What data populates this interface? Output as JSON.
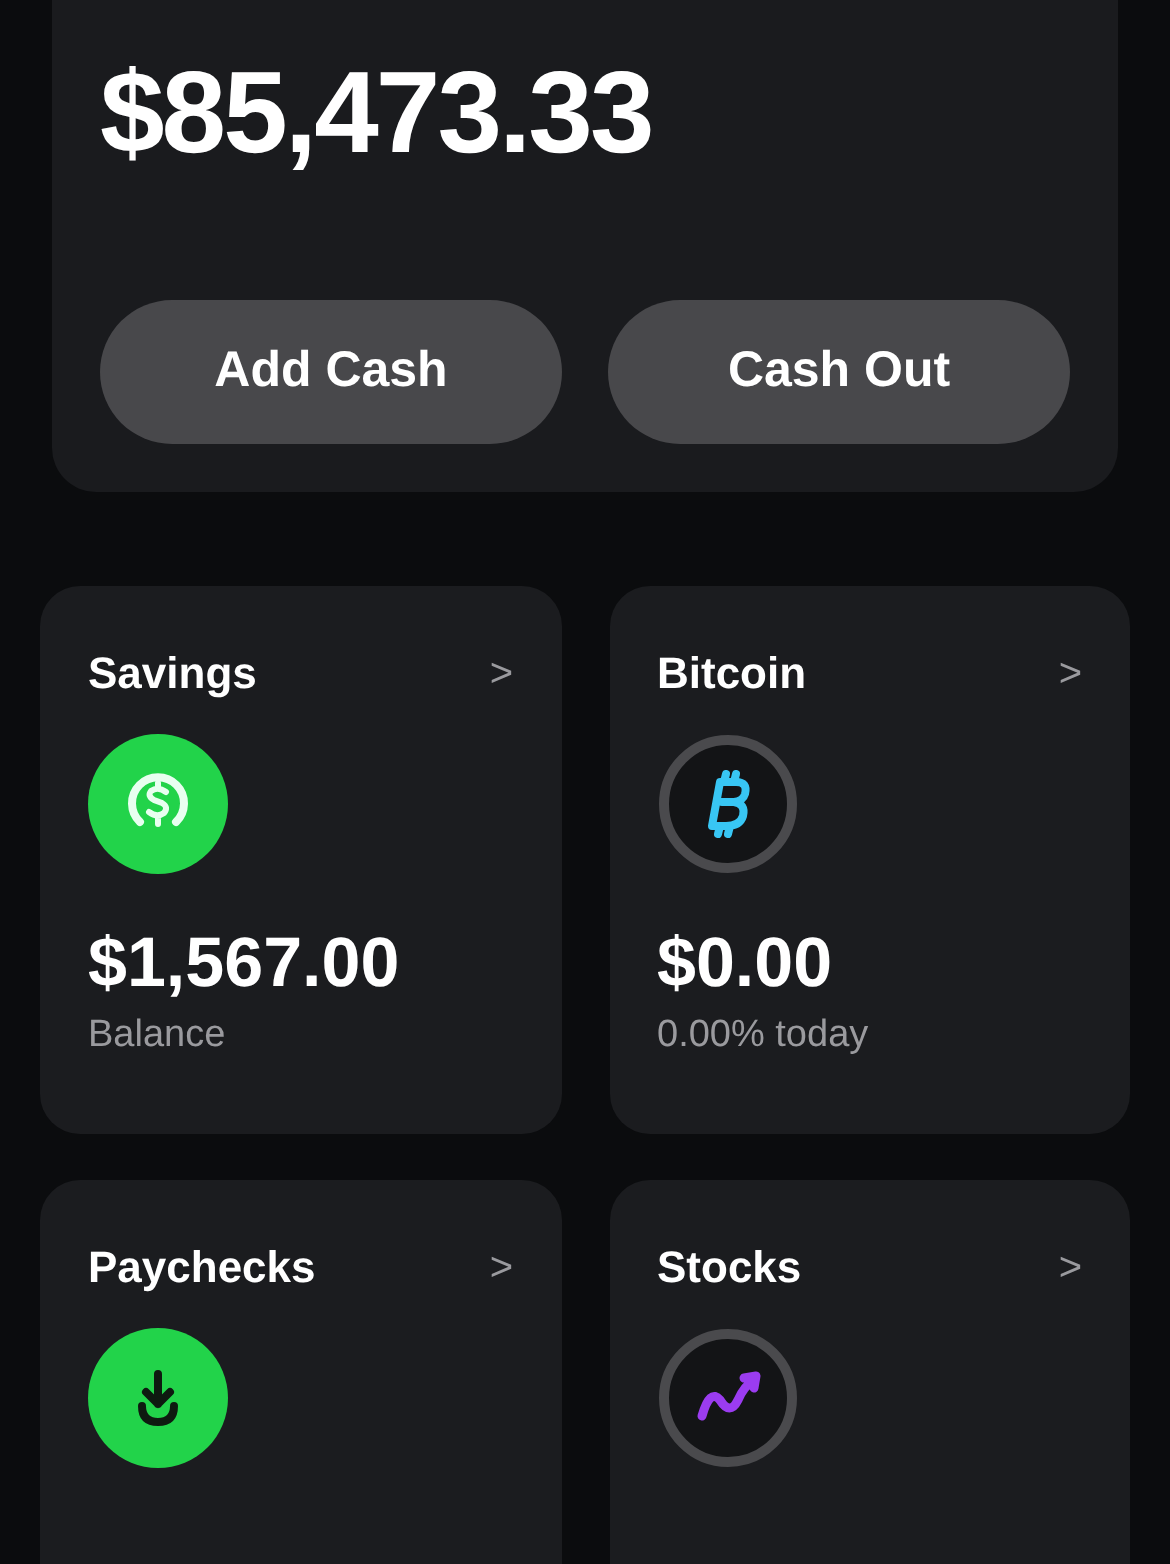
{
  "balance": "$85,473.33",
  "buttons": [
    "Add Cash",
    "Cash Out"
  ],
  "tiles": [
    {
      "title": "Savings",
      "chevron": ">",
      "amount": "$1,567.00",
      "caption": "Balance"
    },
    {
      "title": "Bitcoin",
      "chevron": ">",
      "amount": "$0.00",
      "caption": "0.00% today"
    },
    {
      "title": "Paychecks",
      "chevron": ">"
    },
    {
      "title": "Stocks",
      "chevron": ">"
    }
  ]
}
